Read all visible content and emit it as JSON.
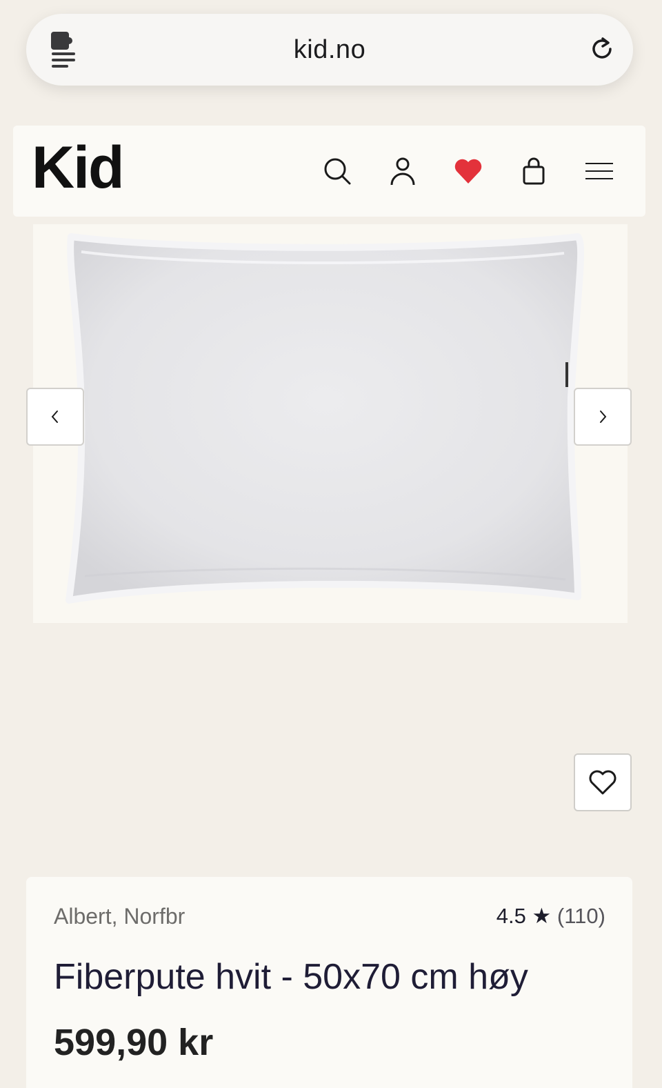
{
  "browser": {
    "url": "kid.no",
    "extension_icon": "extensions-menu-icon",
    "reload_icon": "reload-icon"
  },
  "header": {
    "logo": "Kid",
    "icons": [
      "search-icon",
      "account-icon",
      "heart-icon",
      "shopping-bag-icon",
      "menu-icon"
    ],
    "heart_color": "#e3323b"
  },
  "gallery": {
    "prev_icon": "chevron-left-icon",
    "next_icon": "chevron-right-icon",
    "favorite_icon": "heart-outline-icon"
  },
  "product": {
    "brand": "Albert, Norfbr",
    "rating_value": "4.5",
    "rating_star": "★",
    "rating_count": "(110)",
    "title": "Fiberpute hvit - 50x70 cm høy",
    "price": "599,90 kr"
  }
}
